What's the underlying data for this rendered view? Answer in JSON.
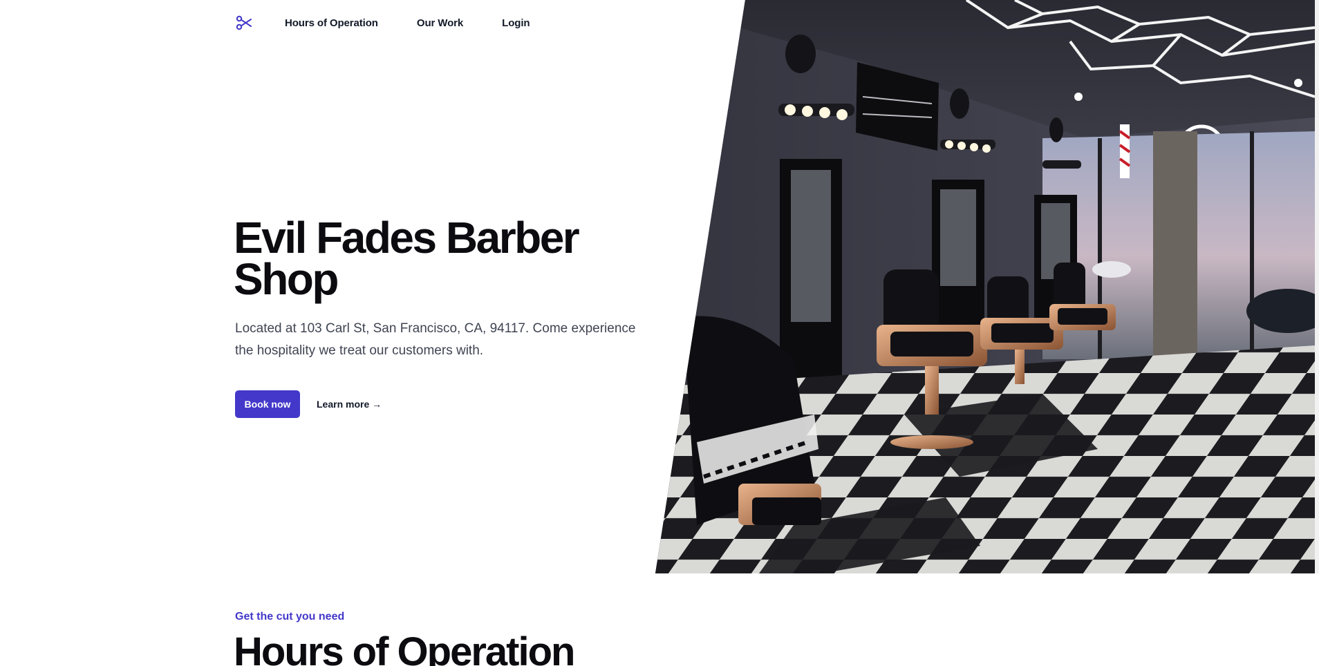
{
  "nav": {
    "logo_icon": "scissors-icon",
    "links": [
      {
        "label": "Hours of Operation"
      },
      {
        "label": "Our Work"
      },
      {
        "label": "Login"
      }
    ]
  },
  "hero": {
    "title": "Evil Fades Barber Shop",
    "description": "Located at 103 Carl St, San Francisco, CA, 94117. Come experience the hospitality we treat our customers with.",
    "primary_button": "Book now",
    "secondary_link": "Learn more →",
    "image_subject": "barber-shop-interior-photo"
  },
  "hours_section": {
    "eyebrow": "Get the cut you need",
    "title": "Hours of Operation"
  },
  "colors": {
    "accent": "#4338ca",
    "heading": "#0b0b10",
    "body_text": "#3f4452"
  }
}
